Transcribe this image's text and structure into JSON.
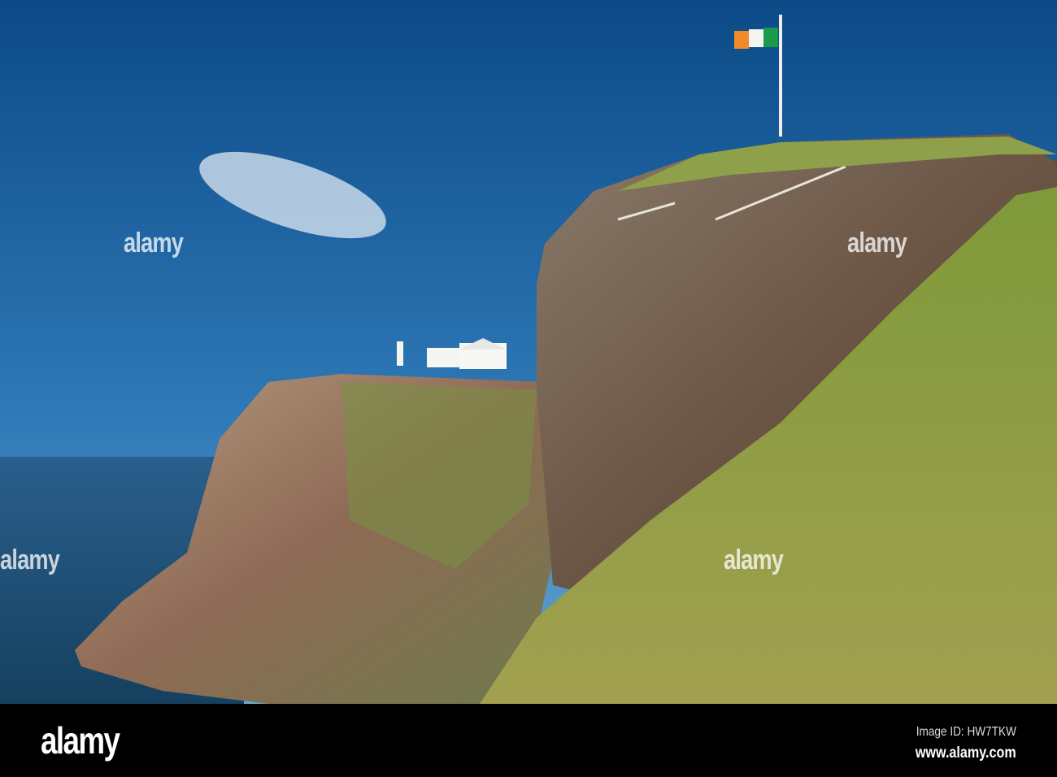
{
  "watermark": {
    "text": "alamy"
  },
  "footer": {
    "logo": "alamy",
    "image_id": "Image ID: HW7TKW",
    "url": "www.alamy.com"
  },
  "colors": {
    "sky_top": "#0d4f8c",
    "sky_bottom": "#4c92c8",
    "sea": "#1d4f78",
    "footer": "#000000"
  }
}
